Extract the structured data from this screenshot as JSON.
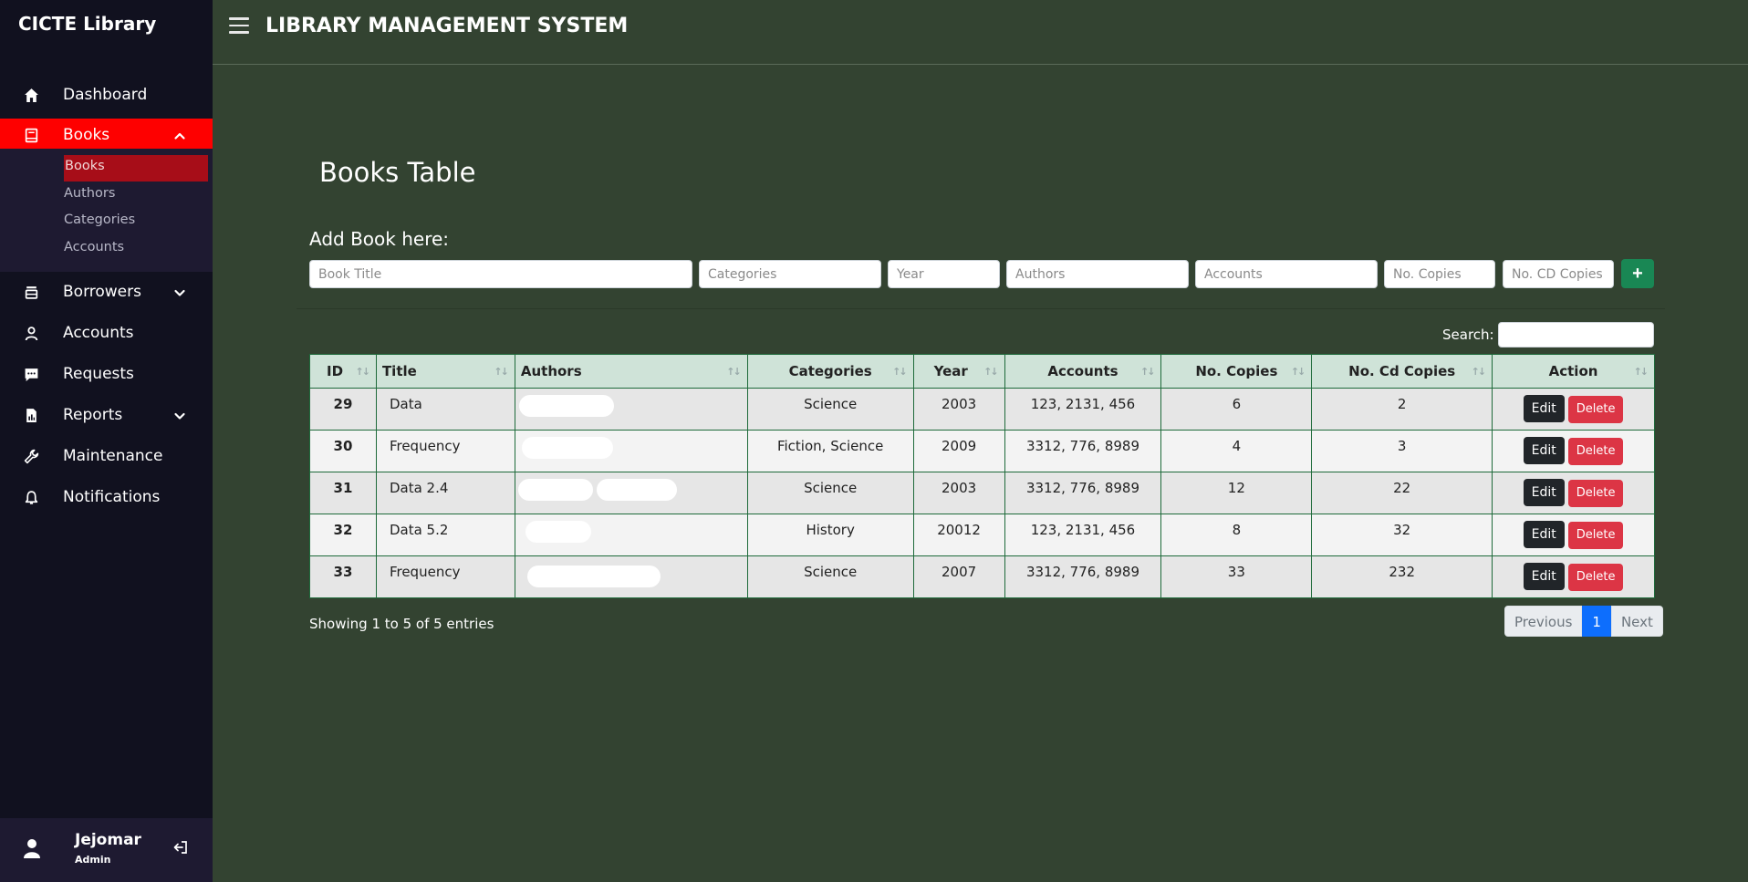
{
  "sidebar": {
    "brand": "CICTE Library",
    "items": [
      {
        "label": "Dashboard",
        "icon": "home-icon"
      },
      {
        "label": "Books",
        "icon": "book-icon",
        "expanded": true
      },
      {
        "label": "Borrowers",
        "icon": "borrowers-icon"
      },
      {
        "label": "Accounts",
        "icon": "user-icon"
      },
      {
        "label": "Requests",
        "icon": "chat-icon"
      },
      {
        "label": "Reports",
        "icon": "report-icon"
      },
      {
        "label": "Maintenance",
        "icon": "wrench-icon"
      },
      {
        "label": "Notifications",
        "icon": "bell-icon"
      }
    ],
    "books_submenu": [
      "Books",
      "Authors",
      "Categories",
      "Accounts"
    ],
    "user": {
      "name": "Jejomar",
      "role": "Admin"
    }
  },
  "header": {
    "title": "LIBRARY MANAGEMENT SYSTEM"
  },
  "main": {
    "page_title": "Books Table",
    "add_label": "Add Book here:",
    "form": {
      "title_placeholder": "Book Title",
      "categories_placeholder": "Categories",
      "year_placeholder": "Year",
      "authors_placeholder": "Authors",
      "accounts_placeholder": "Accounts",
      "copies_placeholder": "No. Copies",
      "cd_copies_placeholder": "No. CD Copies",
      "add_button": "+"
    },
    "search_label": "Search:",
    "table": {
      "columns": [
        "ID",
        "Title",
        "Authors",
        "Categories",
        "Year",
        "Accounts",
        "No. Copies",
        "No. Cd Copies",
        "Action"
      ],
      "rows": [
        {
          "id": "29",
          "title": "Data",
          "categories": "Science",
          "year": "2003",
          "accounts": "123, 2131, 456",
          "copies": "6",
          "cd_copies": "2"
        },
        {
          "id": "30",
          "title": "Frequency",
          "categories": "Fiction, Science",
          "year": "2009",
          "accounts": "3312, 776, 8989",
          "copies": "4",
          "cd_copies": "3"
        },
        {
          "id": "31",
          "title": "Data 2.4",
          "categories": "Science",
          "year": "2003",
          "accounts": "3312, 776, 8989",
          "copies": "12",
          "cd_copies": "22"
        },
        {
          "id": "32",
          "title": "Data 5.2",
          "categories": "History",
          "year": "20012",
          "accounts": "123, 2131, 456",
          "copies": "8",
          "cd_copies": "32"
        },
        {
          "id": "33",
          "title": "Frequency",
          "categories": "Science",
          "year": "2007",
          "accounts": "3312, 776, 8989",
          "copies": "33",
          "cd_copies": "232"
        }
      ],
      "edit_label": "Edit",
      "delete_label": "Delete"
    },
    "info": "Showing 1 to 5 of 5 entries",
    "pagination": {
      "previous": "Previous",
      "current": "1",
      "next": "Next"
    }
  }
}
